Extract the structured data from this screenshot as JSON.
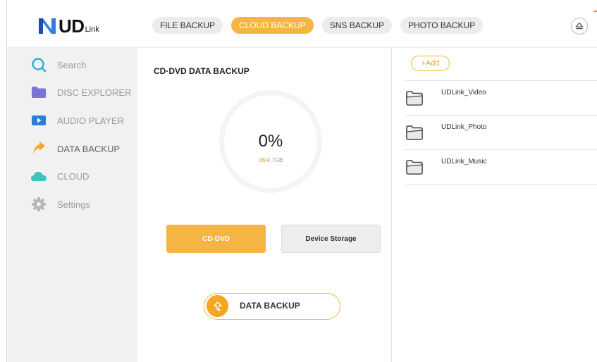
{
  "app": {
    "logo_main": "UD",
    "logo_sub": "Link",
    "brand_colors": {
      "accent": "#f5b544",
      "accent_dark": "#f5a623",
      "logo_blue": "#2f7de1"
    }
  },
  "tabs": [
    {
      "label": "FILE BACKUP",
      "active": false
    },
    {
      "label": "CLOUD BACKUP",
      "active": true
    },
    {
      "label": "SNS BACKUP",
      "active": false
    },
    {
      "label": "PHOTO BACKUP",
      "active": false
    }
  ],
  "header_icons": {
    "eject": "eject-icon"
  },
  "sidebar": {
    "items": [
      {
        "label": "Search",
        "icon": "search-icon"
      },
      {
        "label": "DISC EXPLORER",
        "icon": "folder-icon"
      },
      {
        "label": "AUDIO PLAYER",
        "icon": "play-icon"
      },
      {
        "label": "DATA BACKUP",
        "icon": "backup-arrow-icon",
        "active": true
      },
      {
        "label": "CLOUD",
        "icon": "cloud-icon"
      },
      {
        "label": "Settings",
        "icon": "gear-icon"
      }
    ]
  },
  "main": {
    "title": "CD·DVD  DATA BACKUP",
    "progress": {
      "percent_text": "0%",
      "used": "0B",
      "total": "/4.7GB",
      "fraction": 0
    },
    "source_buttons": {
      "cd_dvd": "CD-DVD",
      "device_storage": "Device Storage",
      "selected": "cd_dvd"
    },
    "backup_button": "DATA BACKUP"
  },
  "right": {
    "add_label": "+Add",
    "folders": [
      {
        "name": "UDLink_Video",
        "icon": "folder-icon"
      },
      {
        "name": "UDLink_Photo",
        "icon": "folder-icon"
      },
      {
        "name": "UDLink_Music",
        "icon": "folder-icon"
      }
    ]
  }
}
